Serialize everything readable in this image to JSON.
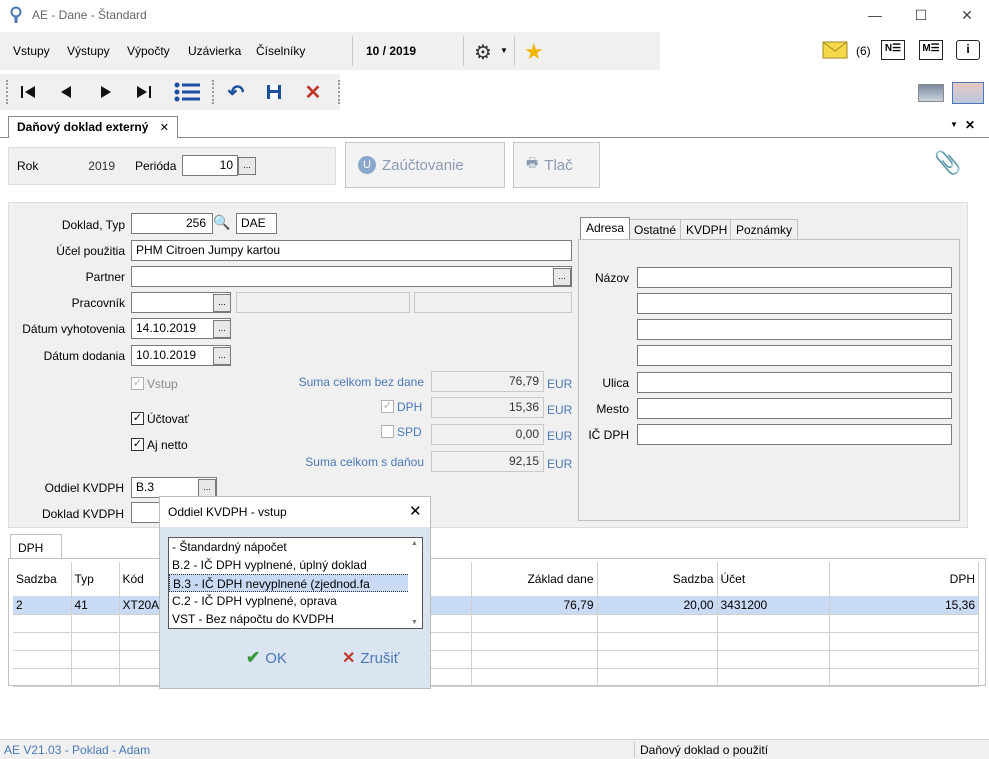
{
  "window": {
    "title": "AE - Dane - Štandard"
  },
  "menu": {
    "items": [
      "Vstupy",
      "Výstupy",
      "Výpočty",
      "Uzávierka",
      "Číselníky"
    ],
    "period": "10 / 2019",
    "mail_count": "(6)"
  },
  "doc_tab": {
    "label": "Daňový doklad externý"
  },
  "top_panel": {
    "rok_label": "Rok",
    "rok_value": "2019",
    "perioda_label": "Perióda",
    "perioda_value": "10",
    "zauctovanie_label": "Zaúčtovanie",
    "tlac_label": "Tlač"
  },
  "form": {
    "doklad_typ_label": "Doklad, Typ",
    "doklad_value": "256",
    "typ_value": "DAE",
    "ucel_label": "Účel použitia",
    "ucel_value": "PHM Citroen Jumpy kartou",
    "partner_label": "Partner",
    "partner_value": "",
    "pracovnik_label": "Pracovník",
    "pracovnik_value": "",
    "datum_vyhotovenia_label": "Dátum vyhotovenia",
    "datum_vyhotovenia_value": "14.10.2019",
    "datum_dodania_label": "Dátum dodania",
    "datum_dodania_value": "10.10.2019",
    "vstup_label": "Vstup",
    "uctovat_label": "Účtovať",
    "aj_netto_label": "Aj netto",
    "oddiel_label": "Oddiel KVDPH",
    "oddiel_value": "B.3",
    "doklad_kvdph_label": "Doklad KVDPH",
    "doklad_kvdph_value": ""
  },
  "sums": {
    "bez_dane_label": "Suma celkom bez dane",
    "bez_dane_value": "76,79",
    "dph_label": "DPH",
    "dph_value": "15,36",
    "spd_label": "SPD",
    "spd_value": "0,00",
    "s_danou_label": "Suma celkom s daňou",
    "s_danou_value": "92,15",
    "currency": "EUR"
  },
  "right_panel": {
    "tabs": [
      "Adresa",
      "Ostatné",
      "KVDPH",
      "Poznámky"
    ],
    "nazov_label": "Názov",
    "ulica_label": "Ulica",
    "mesto_label": "Mesto",
    "ic_dph_label": "IČ DPH"
  },
  "grid": {
    "tab_label": "DPH",
    "headers": [
      "Sadzba",
      "Typ",
      "Kód",
      "Základ dane",
      "Sadzba",
      "Účet",
      "DPH"
    ],
    "row": [
      "2",
      "41",
      "XT20A",
      "76,79",
      "20,00",
      "3431200",
      "15,36"
    ]
  },
  "dialog": {
    "title": "Oddiel KVDPH - vstup",
    "items": [
      "- Štandardný nápočet",
      "B.2 - IČ DPH vyplnené, úplný doklad",
      "B.3 - IČ DPH nevyplnené (zjednod.fa",
      "C.2 - IČ DPH vyplnené, oprava",
      "VST - Bez nápočtu do KVDPH"
    ],
    "selected_index": 2,
    "ok_label": "OK",
    "cancel_label": "Zrušiť"
  },
  "status": {
    "left": "AE V21.03 - Poklad - Adam",
    "right": "Daňový doklad o použití"
  },
  "colors": {
    "accent_blue": "#4a78b8",
    "selection": "#c9daf4",
    "ok_green": "#3a9a3a",
    "cancel_red": "#c0392b"
  }
}
